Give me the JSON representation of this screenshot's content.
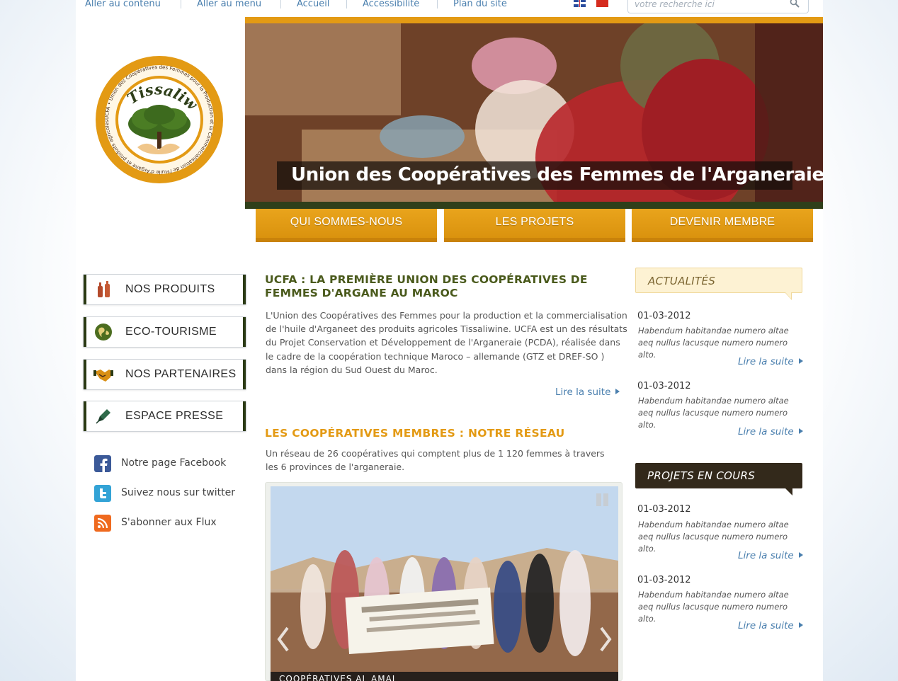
{
  "topnav": {
    "links": [
      "Aller au contenu",
      "Aller au menu",
      "Accueil",
      "Accessibilité",
      "Plan du site"
    ]
  },
  "search": {
    "placeholder": "votre recherche ici"
  },
  "logo": {
    "brand": "Tissaliwine",
    "ring_text": "UCFA • Union des Coopératives des Femmes pour la Production et la Commercialisation de l'Huile d'Argane et produits agricoles •"
  },
  "banner": {
    "title": "Union des Coopératives des Femmes de l'Arganeraie"
  },
  "main_tabs": [
    "QUI SOMMES-NOUS",
    "LES PROJETS",
    "DEVENIR MEMBRE"
  ],
  "sidebar": {
    "buttons": [
      "NOS PRODUITS",
      "ECO-TOURISME",
      "NOS PARTENAIRES",
      "ESPACE PRESSE"
    ],
    "social": [
      "Notre page Facebook",
      "Suivez nous sur twitter",
      "S'abonner aux Flux"
    ]
  },
  "article": {
    "title": "UCFA : LA PREMIÈRE UNION DES COOPÉRATIVES DE FEMMES D'ARGANE AU MAROC",
    "body": "L'Union des Coopératives des Femmes pour la production et la commercialisation de l'huile d'Arganeet des produits agricoles Tissaliwine. UCFA est un des résultats du Projet Conservation et Développement de l'Arganeraie (PCDA), réalisée dans le cadre de la coopération technique Maroco – allemande (GTZ et DREF-SO ) dans la région du Sud Ouest du Maroc.",
    "read_more": "Lire la suite"
  },
  "network": {
    "title": "LES COOPÉRATIVES MEMBRES : NOTRE RÉSEAU",
    "body": "Un réseau de 26 coopératives qui comptent plus de 1 120 femmes à travers les 6 provinces de l'arganeraie.",
    "slide_caption": "COOPÉRATIVES AL AMAL"
  },
  "news": {
    "title": "ACTUALITÉS",
    "items": [
      {
        "date": "01-03-2012",
        "text": "Habendum habitandae numero altae aeq nullus lacusque numero numero alto.",
        "more": "Lire la suite"
      },
      {
        "date": "01-03-2012",
        "text": "Habendum habitandae numero altae aeq nullus lacusque numero numero alto.",
        "more": "Lire la suite"
      }
    ]
  },
  "projects": {
    "title": "PROJETS EN COURS",
    "items": [
      {
        "date": "01-03-2012",
        "text": "Habendum habitandae numero altae aeq nullus lacusque numero numero alto.",
        "more": "Lire la suite"
      },
      {
        "date": "01-03-2012",
        "text": "Habendum habitandae numero altae aeq nullus lacusque numero numero alto.",
        "more": "Lire la suite"
      }
    ]
  },
  "colors": {
    "accent_orange": "#e39a14",
    "dark_olive": "#2f3f1a",
    "link_blue": "#4a7fae",
    "heading_olive": "#4a5a1c"
  }
}
